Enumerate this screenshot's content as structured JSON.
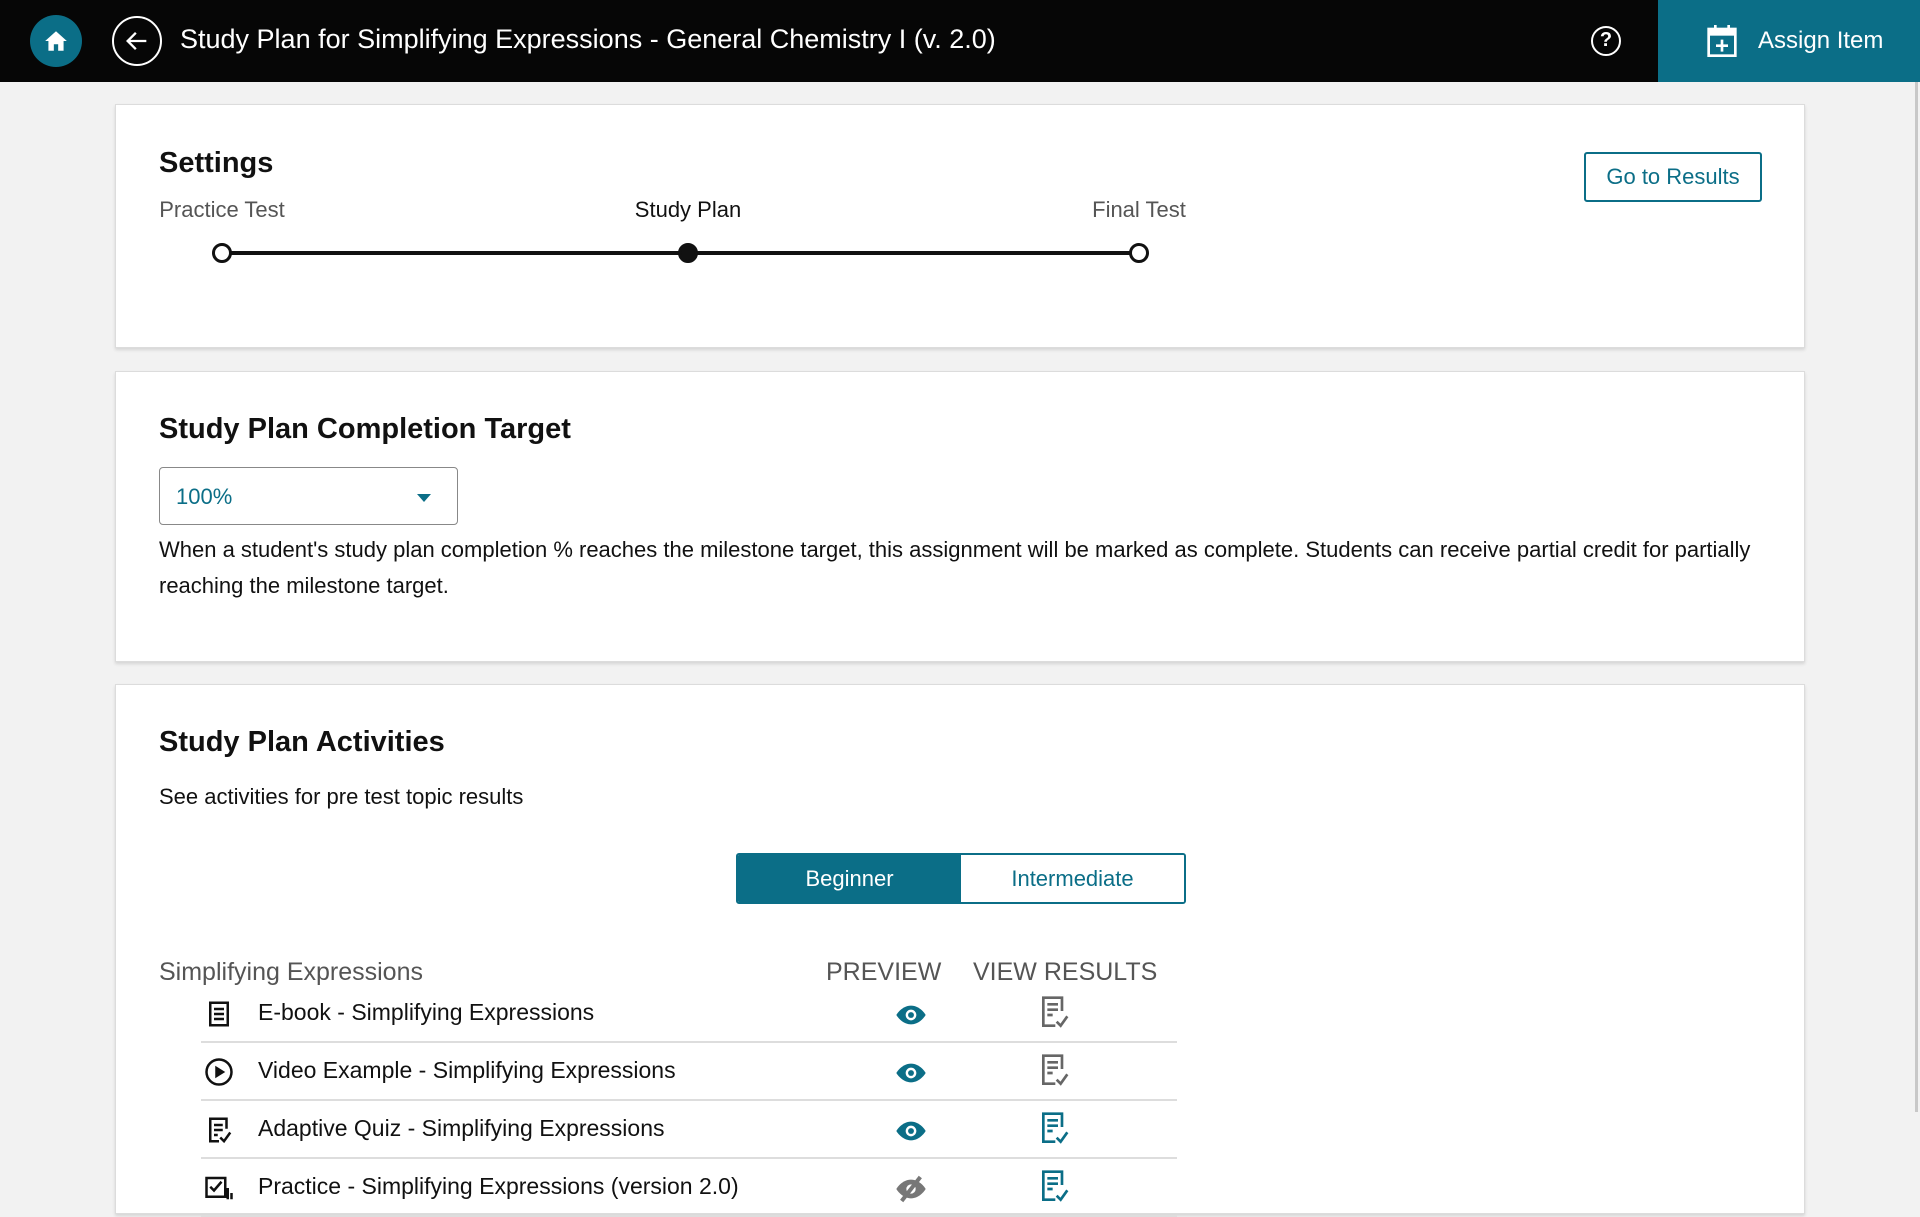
{
  "header": {
    "title": "Study Plan for Simplifying Expressions - General Chemistry I (v. 2.0)",
    "help_label": "?",
    "assign_label": "Assign Item"
  },
  "colors": {
    "accent": "#0b6e87",
    "header_bg": "#060606"
  },
  "settings": {
    "title": "Settings",
    "go_to_results": "Go to Results",
    "steps": [
      "Practice Test",
      "Study Plan",
      "Final Test"
    ],
    "active_step": "Study Plan"
  },
  "completion": {
    "title": "Study Plan Completion Target",
    "selected": "100%",
    "description": "When a student's study plan completion % reaches the milestone target, this assignment will be marked as complete. Students can receive partial credit for partially reaching the milestone target."
  },
  "activities": {
    "title": "Study Plan Activities",
    "subtitle": "See activities for pre test topic results",
    "tabs": [
      "Beginner",
      "Intermediate"
    ],
    "active_tab": "Beginner",
    "table": {
      "topic": "Simplifying Expressions",
      "col_preview": "PREVIEW",
      "col_results": "VIEW RESULTS",
      "rows": [
        {
          "name": "E-book - Simplifying Expressions",
          "icon": "ebook-icon",
          "preview": "eye-icon",
          "results_active": false
        },
        {
          "name": "Video Example - Simplifying Expressions",
          "icon": "play-circle-icon",
          "preview": "eye-icon",
          "results_active": false
        },
        {
          "name": "Adaptive Quiz - Simplifying Expressions",
          "icon": "quiz-icon",
          "preview": "eye-icon",
          "results_active": true
        },
        {
          "name": "Practice - Simplifying Expressions (version 2.0)",
          "icon": "practice-icon",
          "preview": "eye-slash-icon",
          "results_active": true
        }
      ]
    }
  }
}
